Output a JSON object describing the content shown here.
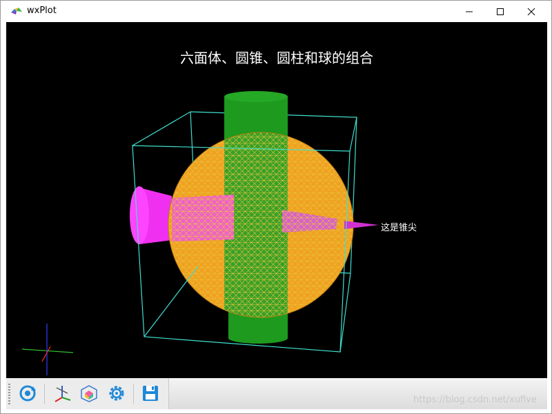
{
  "window": {
    "title": "wxPlot",
    "minimize_icon": "minimize-icon",
    "maximize_icon": "maximize-icon",
    "close_icon": "close-icon"
  },
  "plot": {
    "title": "六面体、圆锥、圆柱和球的组合",
    "annotation": "这是锥尖",
    "background": "#000000",
    "colors": {
      "cube_edges": "#40e0d0",
      "cylinder": "#1e9a1e",
      "cone": "#ff33ff",
      "sphere": "#f0a020",
      "sphere_wire": "#e6c020"
    }
  },
  "toolbar": {
    "buttons": [
      {
        "name": "rotate-home-icon",
        "tooltip": ""
      },
      {
        "name": "axes-icon",
        "tooltip": ""
      },
      {
        "name": "cube-view-icon",
        "tooltip": ""
      },
      {
        "name": "settings-gear-icon",
        "tooltip": ""
      },
      {
        "name": "save-icon",
        "tooltip": ""
      }
    ]
  },
  "watermark": "https://blog.csdn.net/xufive"
}
